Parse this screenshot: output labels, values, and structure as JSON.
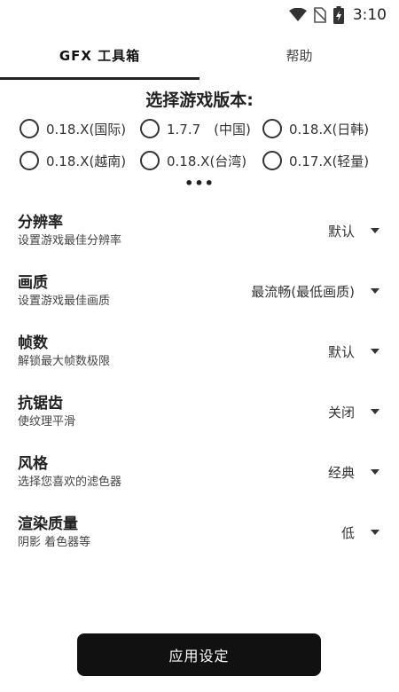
{
  "status_bar": {
    "time": "3:10",
    "icons": [
      "wifi-icon",
      "no-sim-icon",
      "battery-charging-icon"
    ]
  },
  "tabs": [
    {
      "label": "GFX 工具箱",
      "active": true
    },
    {
      "label": "帮助",
      "active": false
    }
  ],
  "version_section": {
    "title": "选择游戏版本:",
    "options": [
      "0.18.X(国际)",
      "1.7.7　(中国)",
      "0.18.X(日韩)",
      "0.18.X(越南)",
      "0.18.X(台湾)",
      "0.17.X(轻量)"
    ],
    "more": "•••"
  },
  "settings": [
    {
      "title": "分辨率",
      "description": "设置游戏最佳分辨率",
      "value": "默认"
    },
    {
      "title": "画质",
      "description": "设置游戏最佳画质",
      "value": "最流畅(最低画质)"
    },
    {
      "title": "帧数",
      "description": "解锁最大帧数极限",
      "value": "默认"
    },
    {
      "title": "抗锯齿",
      "description": "使纹理平滑",
      "value": "关闭"
    },
    {
      "title": "风格",
      "description": "选择您喜欢的滤色器",
      "value": "经典"
    },
    {
      "title": "渲染质量",
      "description": "阴影 着色器等",
      "value": "低"
    }
  ],
  "apply_button": {
    "label": "应用设定"
  },
  "colors": {
    "primary": "#111111",
    "background": "#ffffff",
    "text": "#222222"
  }
}
